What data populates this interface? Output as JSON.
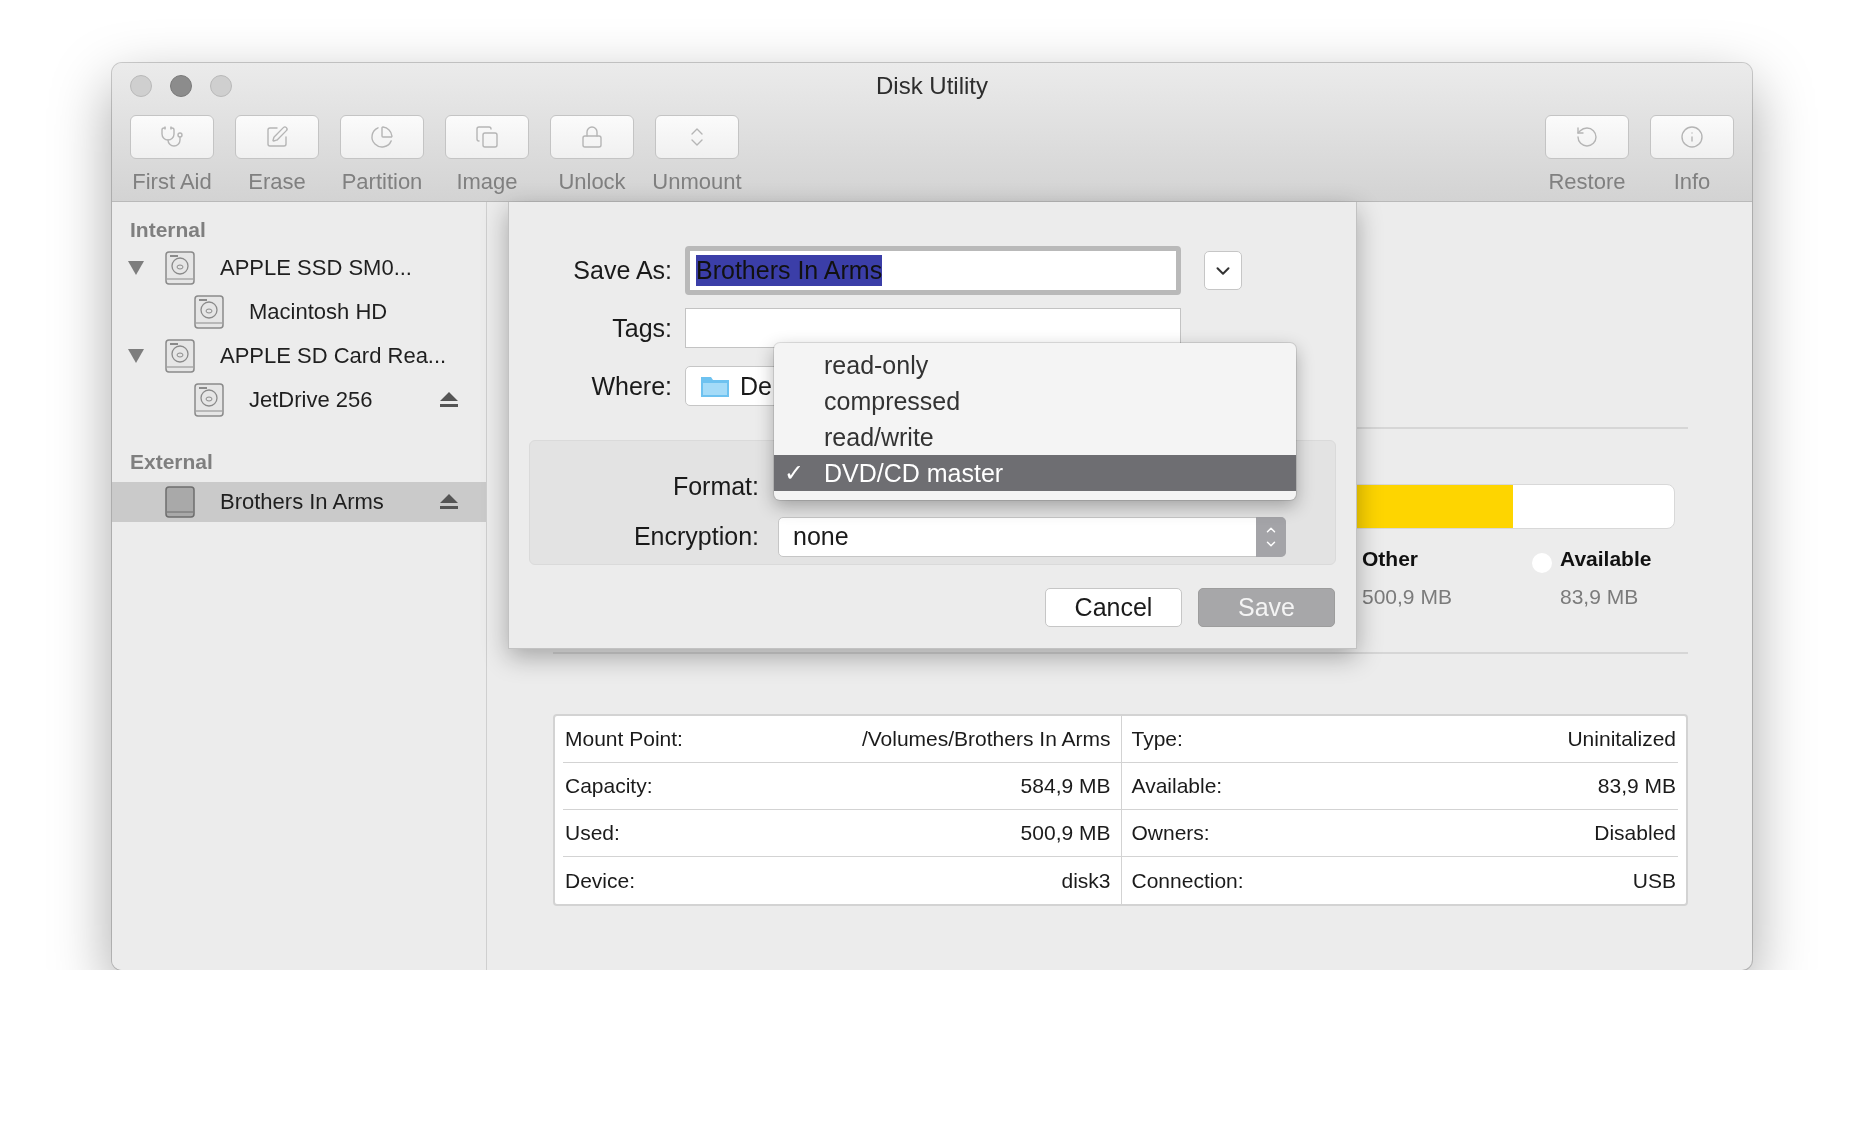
{
  "window": {
    "title": "Disk Utility"
  },
  "toolbar": {
    "left": [
      {
        "label": "First Aid",
        "disabled": true
      },
      {
        "label": "Erase",
        "disabled": true
      },
      {
        "label": "Partition",
        "disabled": true
      },
      {
        "label": "Image",
        "disabled": true
      },
      {
        "label": "Unlock",
        "disabled": true
      },
      {
        "label": "Unmount",
        "disabled": true
      }
    ],
    "right": [
      {
        "label": "Restore",
        "disabled": true
      },
      {
        "label": "Info",
        "disabled": true
      }
    ]
  },
  "sidebar": {
    "sections": [
      {
        "title": "Internal",
        "items": [
          {
            "name": "APPLE SSD SM0...",
            "kind": "internal",
            "expanded": true,
            "selected": false,
            "ejectable": false,
            "children": [
              {
                "name": "Macintosh HD",
                "kind": "internal",
                "selected": false,
                "ejectable": false
              }
            ]
          },
          {
            "name": "APPLE SD Card Rea...",
            "kind": "internal",
            "expanded": true,
            "selected": false,
            "ejectable": false,
            "children": [
              {
                "name": "JetDrive 256",
                "kind": "internal",
                "selected": false,
                "ejectable": true
              }
            ]
          }
        ]
      },
      {
        "title": "External",
        "items": [
          {
            "name": "Brothers In Arms",
            "kind": "external",
            "selected": true,
            "ejectable": true
          }
        ]
      }
    ]
  },
  "usage": {
    "level": 0.856,
    "legend": [
      {
        "label": "Other",
        "value": "500,9 MB"
      },
      {
        "label": "Available",
        "value": "83,9 MB",
        "color": "#ffffff"
      }
    ]
  },
  "info_table": {
    "rows": [
      [
        {
          "label": "Mount Point:",
          "value": "/Volumes/Brothers In Arms"
        },
        {
          "label": "Type:",
          "value": "Uninitalized"
        }
      ],
      [
        {
          "label": "Capacity:",
          "value": "584,9 MB"
        },
        {
          "label": "Available:",
          "value": "83,9 MB"
        }
      ],
      [
        {
          "label": "Used:",
          "value": "500,9 MB"
        },
        {
          "label": "Owners:",
          "value": "Disabled"
        }
      ],
      [
        {
          "label": "Device:",
          "value": "disk3"
        },
        {
          "label": "Connection:",
          "value": "USB"
        }
      ]
    ]
  },
  "dialog": {
    "save_as": {
      "label": "Save As:",
      "value": "Brothers In Arms",
      "text_selected": true
    },
    "tags": {
      "label": "Tags:"
    },
    "where": {
      "label": "Where:",
      "value": "De"
    },
    "format": {
      "label": "Format:"
    },
    "encryption": {
      "label": "Encryption:",
      "value": "none"
    },
    "buttons": [
      {
        "label": "Cancel",
        "kind": "cancel",
        "disabled": false
      },
      {
        "label": "Save",
        "kind": "default",
        "disabled": true
      }
    ]
  },
  "format_menu": {
    "check": "✓",
    "items": [
      {
        "label": "read-only",
        "selected": false
      },
      {
        "label": "compressed",
        "selected": false
      },
      {
        "label": "read/write",
        "selected": false
      },
      {
        "label": "DVD/CD master",
        "selected": true
      }
    ]
  }
}
